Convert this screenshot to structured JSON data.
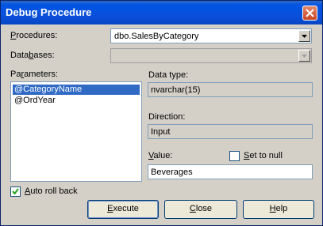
{
  "window": {
    "title": "Debug Procedure"
  },
  "form": {
    "procedures_label": "Procedures:",
    "procedures_value": "dbo.SalesByCategory",
    "databases_label": "Databases:",
    "databases_value": "",
    "parameters_label": "Parameters:",
    "parameters": [
      "@CategoryName",
      "@OrdYear"
    ],
    "selected_parameter_index": 0,
    "data_type_label": "Data type:",
    "data_type_value": "nvarchar(15)",
    "direction_label": "Direction:",
    "direction_value": "Input",
    "value_label": "Value:",
    "value_value": "Beverages",
    "set_to_null_label": "Set to null",
    "set_to_null_checked": false,
    "auto_roll_back_label": "Auto roll back",
    "auto_roll_back_checked": true
  },
  "buttons": {
    "execute": "Execute",
    "close": "Close",
    "help": "Help"
  }
}
